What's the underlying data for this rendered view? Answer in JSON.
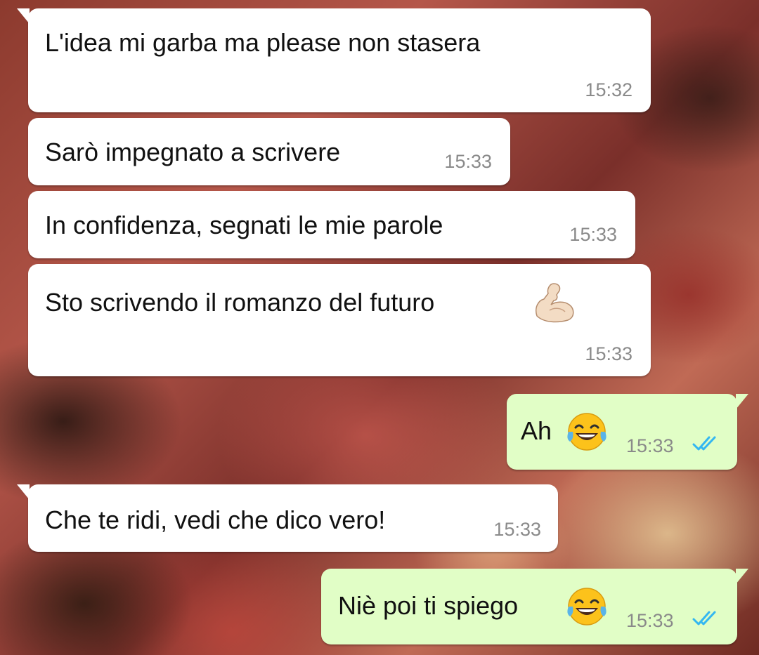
{
  "messages": [
    {
      "direction": "incoming",
      "text": "L'idea mi garba ma please non stasera",
      "time": "15:32"
    },
    {
      "direction": "incoming",
      "text": "Sarò impegnato a scrivere",
      "time": "15:33"
    },
    {
      "direction": "incoming",
      "text": "In confidenza, segnati le mie parole",
      "time": "15:33"
    },
    {
      "direction": "incoming",
      "text": "Sto scrivendo il romanzo del futuro",
      "emoji": "flexed-biceps-icon",
      "time": "15:33"
    },
    {
      "direction": "outgoing",
      "text": "Ah",
      "emoji": "tears-of-joy-icon",
      "time": "15:33",
      "status": "read-double-check-icon"
    },
    {
      "direction": "incoming",
      "text": "Che te ridi, vedi che dico vero!",
      "time": "15:33"
    },
    {
      "direction": "outgoing",
      "text": "Niè poi ti spiego",
      "emoji": "tears-of-joy-icon",
      "time": "15:33",
      "status": "read-double-check-icon"
    }
  ],
  "colors": {
    "incoming_bubble": "#ffffff",
    "outgoing_bubble": "#e1fec6",
    "timestamp": "#8a8a8a",
    "read_check": "#34b7f1"
  }
}
